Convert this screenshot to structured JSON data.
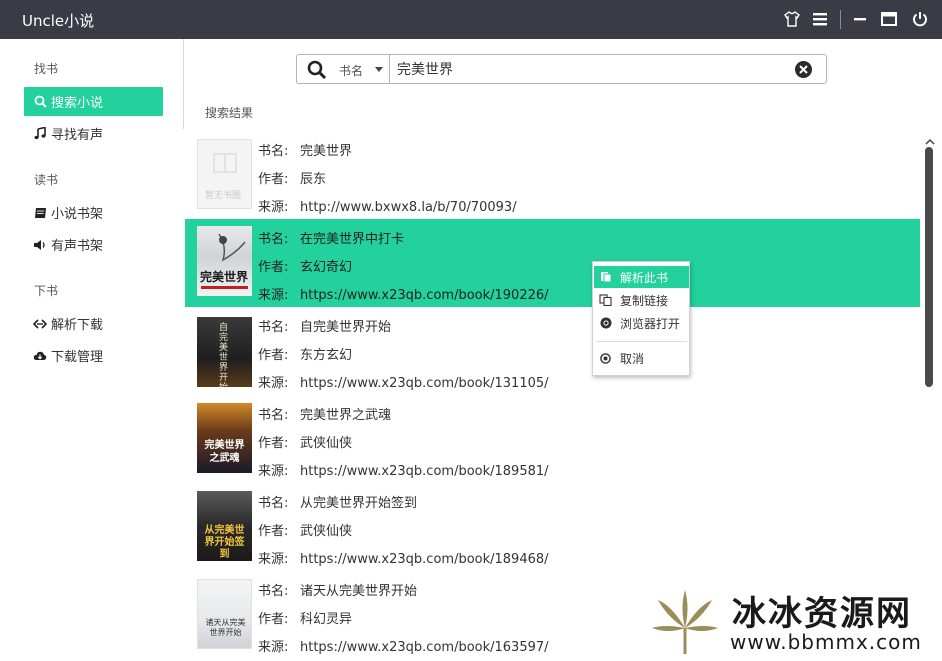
{
  "app": {
    "title": "Uncle小说"
  },
  "titlebar": {
    "icons": [
      "shirt-icon",
      "menu-icon",
      "minimize-icon",
      "maximize-icon",
      "power-icon"
    ]
  },
  "sidebar": {
    "sections": [
      {
        "title": "找书",
        "items": [
          {
            "label": "搜索小说",
            "icon": "search-icon",
            "active": true
          },
          {
            "label": "寻找有声",
            "icon": "music-note-icon"
          }
        ]
      },
      {
        "title": "读书",
        "items": [
          {
            "label": "小说书架",
            "icon": "book-icon"
          },
          {
            "label": "有声书架",
            "icon": "speaker-icon"
          }
        ]
      },
      {
        "title": "下书",
        "items": [
          {
            "label": "解析下载",
            "icon": "link-icon"
          },
          {
            "label": "下载管理",
            "icon": "cloud-download-icon"
          }
        ]
      }
    ]
  },
  "search": {
    "type_label": "书名",
    "query": "完美世界"
  },
  "results_label": "搜索结果",
  "labels": {
    "name": "书名:",
    "author": "作者:",
    "source": "来源:"
  },
  "results": [
    {
      "name": "完美世界",
      "author": "辰东",
      "source": "http://www.bxwx8.la/b/70/70093/",
      "cover_text": "暂无书图"
    },
    {
      "name": "在完美世界中打卡",
      "author": "玄幻奇幻",
      "source": "https://www.x23qb.com/book/190226/",
      "cover_text": "完美世界",
      "selected": true
    },
    {
      "name": "自完美世界开始",
      "author": "东方玄幻",
      "source": "https://www.x23qb.com/book/131105/",
      "cover_text": "自完美世界开始"
    },
    {
      "name": "完美世界之武魂",
      "author": "武侠仙侠",
      "source": "https://www.x23qb.com/book/189581/",
      "cover_text": "完美世界之武魂"
    },
    {
      "name": "从完美世界开始签到",
      "author": "武侠仙侠",
      "source": "https://www.x23qb.com/book/189468/",
      "cover_text": "从完美世界开始签到"
    },
    {
      "name": "诸天从完美世界开始",
      "author": "科幻灵异",
      "source": "https://www.x23qb.com/book/163597/",
      "cover_text": "诸天从完美世界开始"
    }
  ],
  "context_menu": {
    "items": [
      {
        "label": "解析此书",
        "icon": "parse-icon"
      },
      {
        "label": "复制链接",
        "icon": "copy-icon"
      },
      {
        "label": "浏览器打开",
        "icon": "chrome-icon"
      },
      {
        "label": "取消",
        "icon": "cancel-icon"
      }
    ]
  },
  "watermark": {
    "text": "冰冰资源网",
    "url": "www.bbmmx.com"
  },
  "colors": {
    "accent": "#22d19b",
    "titlebar": "#3a3c45"
  }
}
